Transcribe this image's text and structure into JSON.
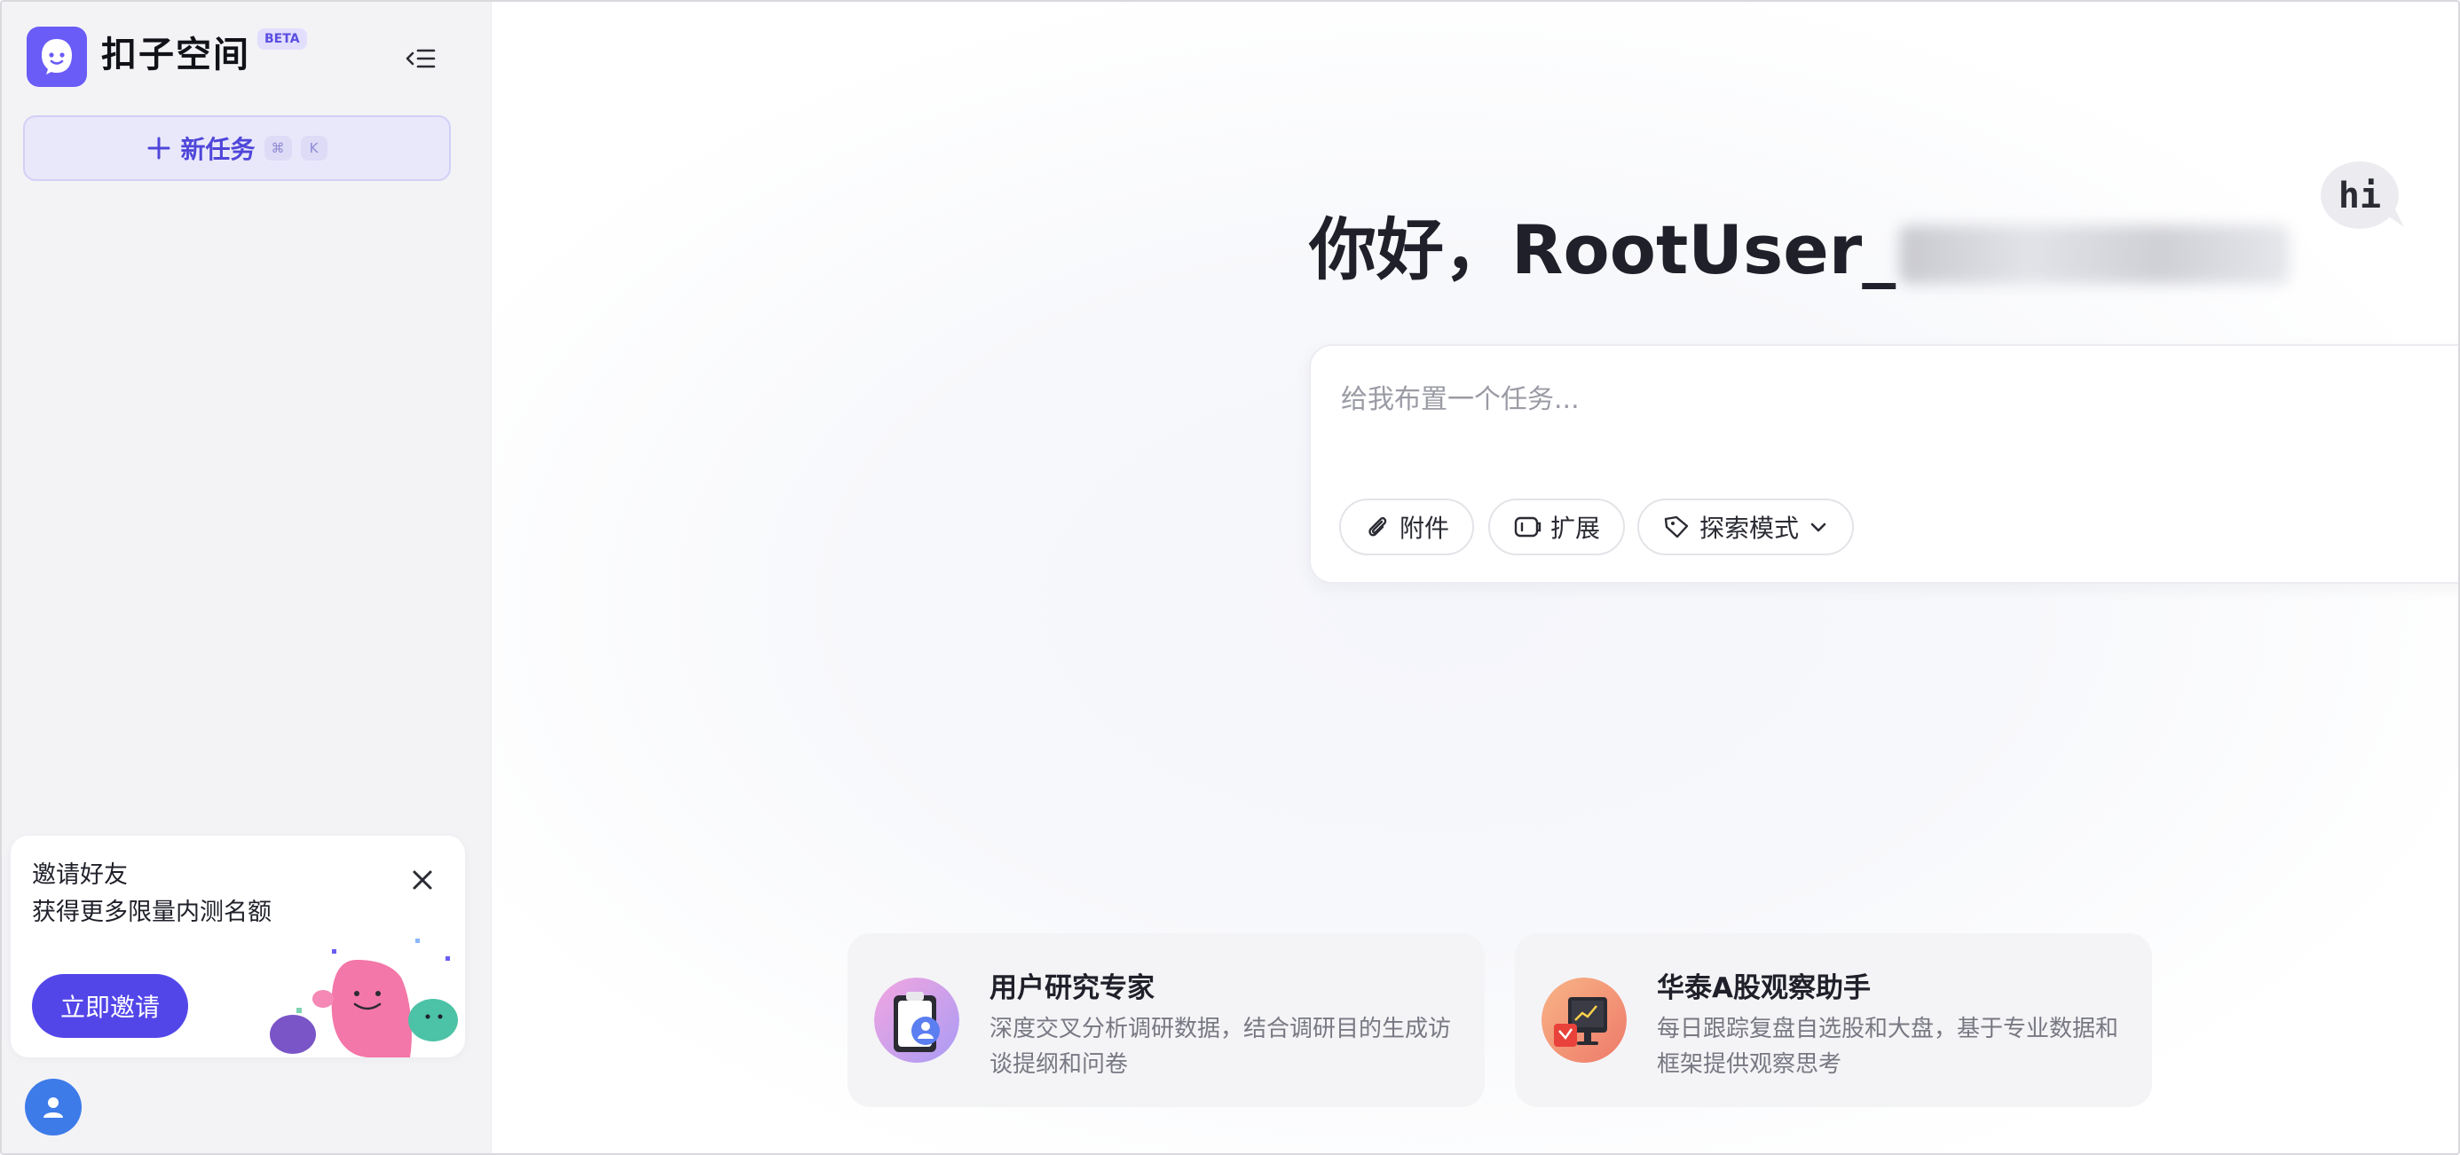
{
  "sidebar": {
    "app_name": "扣子空间",
    "badge": "BETA",
    "new_task": {
      "label": "新任务",
      "shortcut_keys": [
        "⌘",
        "K"
      ]
    },
    "invite": {
      "title": "邀请好友",
      "subtitle": "获得更多限量内测名额",
      "button": "立即邀请"
    }
  },
  "main": {
    "greeting": "你好，RootUser_",
    "mascot_bubble": "hi",
    "task_input": {
      "placeholder": "给我布置一个任务...",
      "value": ""
    },
    "toolbar": {
      "attach": "附件",
      "extend": "扩展",
      "mode": "探索模式"
    },
    "agents": [
      {
        "title": "用户研究专家",
        "desc": "深度交叉分析调研数据，结合调研目的生成访谈提纲和问卷",
        "icon": "clipboard-user-icon"
      },
      {
        "title": "华泰A股观察助手",
        "desc": "每日跟踪复盘自选股和大盘，基于专业数据和框架提供观察思考",
        "icon": "stock-monitor-icon"
      }
    ]
  },
  "colors": {
    "accent": "#5346e9",
    "logo": "#6a5cf6",
    "send_disabled": "#b8b3f7",
    "sidebar_bg": "#f3f3f6"
  }
}
